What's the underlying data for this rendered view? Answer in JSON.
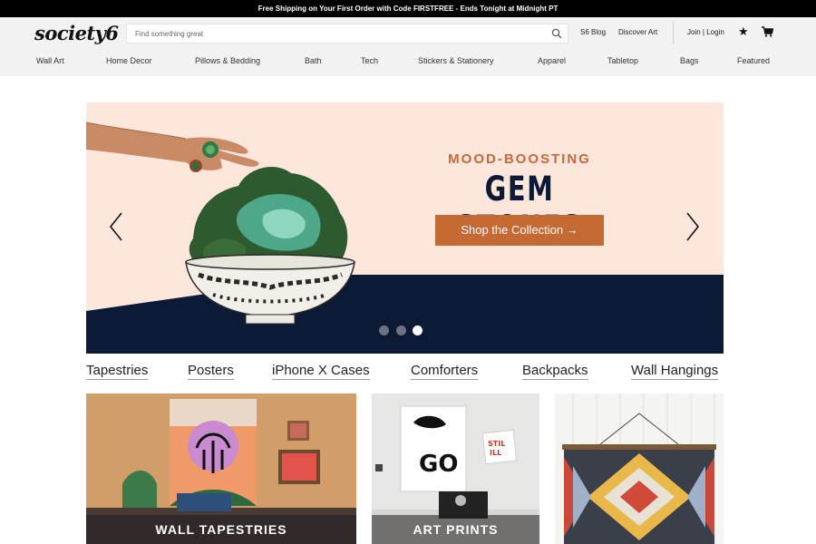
{
  "promo": {
    "text": "Free Shipping on Your First Order with Code FIRSTFREE - Ends Tonight at Midnight PT"
  },
  "header": {
    "logo": "society6",
    "search_placeholder": "Find something great",
    "s6_blog": "S6 Blog",
    "discover_art": "Discover Art",
    "join_login": "Join | Login",
    "wishlist_icon": "star-icon",
    "cart_icon": "cart-icon"
  },
  "nav": {
    "items": [
      {
        "label": "Wall Art"
      },
      {
        "label": "Home Decor"
      },
      {
        "label": "Pillows & Bedding"
      },
      {
        "label": "Bath"
      },
      {
        "label": "Tech"
      },
      {
        "label": "Stickers & Stationery"
      },
      {
        "label": "Apparel"
      },
      {
        "label": "Tabletop"
      },
      {
        "label": "Bags"
      },
      {
        "label": "Featured"
      }
    ]
  },
  "hero": {
    "kicker": "MOOD-BOOSTING",
    "title": "GEM STONES",
    "cta": "Shop the Collection →",
    "slide_count": 3,
    "active_slide": 3,
    "colors": {
      "background": "#fde6dc",
      "dark_band": "#0c1a35",
      "accent": "#c36a35"
    }
  },
  "categories": {
    "links": [
      {
        "label": "Tapestries"
      },
      {
        "label": "Posters"
      },
      {
        "label": "iPhone X Cases"
      },
      {
        "label": "Comforters"
      },
      {
        "label": "Backpacks"
      },
      {
        "label": "Wall Hangings"
      }
    ]
  },
  "tiles": [
    {
      "label": "WALL TAPESTRIES"
    },
    {
      "label": "ART PRINTS"
    },
    {
      "label": ""
    }
  ]
}
